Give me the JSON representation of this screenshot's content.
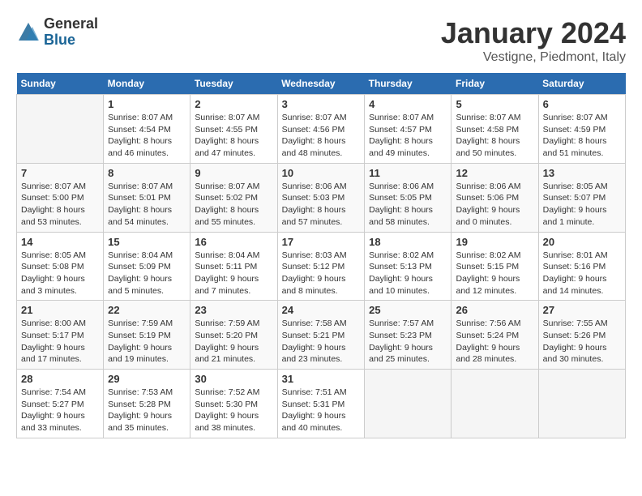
{
  "header": {
    "logo_general": "General",
    "logo_blue": "Blue",
    "title": "January 2024",
    "subtitle": "Vestigne, Piedmont, Italy"
  },
  "columns": [
    "Sunday",
    "Monday",
    "Tuesday",
    "Wednesday",
    "Thursday",
    "Friday",
    "Saturday"
  ],
  "weeks": [
    [
      {
        "day": "",
        "info": ""
      },
      {
        "day": "1",
        "info": "Sunrise: 8:07 AM\nSunset: 4:54 PM\nDaylight: 8 hours\nand 46 minutes."
      },
      {
        "day": "2",
        "info": "Sunrise: 8:07 AM\nSunset: 4:55 PM\nDaylight: 8 hours\nand 47 minutes."
      },
      {
        "day": "3",
        "info": "Sunrise: 8:07 AM\nSunset: 4:56 PM\nDaylight: 8 hours\nand 48 minutes."
      },
      {
        "day": "4",
        "info": "Sunrise: 8:07 AM\nSunset: 4:57 PM\nDaylight: 8 hours\nand 49 minutes."
      },
      {
        "day": "5",
        "info": "Sunrise: 8:07 AM\nSunset: 4:58 PM\nDaylight: 8 hours\nand 50 minutes."
      },
      {
        "day": "6",
        "info": "Sunrise: 8:07 AM\nSunset: 4:59 PM\nDaylight: 8 hours\nand 51 minutes."
      }
    ],
    [
      {
        "day": "7",
        "info": "Sunrise: 8:07 AM\nSunset: 5:00 PM\nDaylight: 8 hours\nand 53 minutes."
      },
      {
        "day": "8",
        "info": "Sunrise: 8:07 AM\nSunset: 5:01 PM\nDaylight: 8 hours\nand 54 minutes."
      },
      {
        "day": "9",
        "info": "Sunrise: 8:07 AM\nSunset: 5:02 PM\nDaylight: 8 hours\nand 55 minutes."
      },
      {
        "day": "10",
        "info": "Sunrise: 8:06 AM\nSunset: 5:03 PM\nDaylight: 8 hours\nand 57 minutes."
      },
      {
        "day": "11",
        "info": "Sunrise: 8:06 AM\nSunset: 5:05 PM\nDaylight: 8 hours\nand 58 minutes."
      },
      {
        "day": "12",
        "info": "Sunrise: 8:06 AM\nSunset: 5:06 PM\nDaylight: 9 hours\nand 0 minutes."
      },
      {
        "day": "13",
        "info": "Sunrise: 8:05 AM\nSunset: 5:07 PM\nDaylight: 9 hours\nand 1 minute."
      }
    ],
    [
      {
        "day": "14",
        "info": "Sunrise: 8:05 AM\nSunset: 5:08 PM\nDaylight: 9 hours\nand 3 minutes."
      },
      {
        "day": "15",
        "info": "Sunrise: 8:04 AM\nSunset: 5:09 PM\nDaylight: 9 hours\nand 5 minutes."
      },
      {
        "day": "16",
        "info": "Sunrise: 8:04 AM\nSunset: 5:11 PM\nDaylight: 9 hours\nand 7 minutes."
      },
      {
        "day": "17",
        "info": "Sunrise: 8:03 AM\nSunset: 5:12 PM\nDaylight: 9 hours\nand 8 minutes."
      },
      {
        "day": "18",
        "info": "Sunrise: 8:02 AM\nSunset: 5:13 PM\nDaylight: 9 hours\nand 10 minutes."
      },
      {
        "day": "19",
        "info": "Sunrise: 8:02 AM\nSunset: 5:15 PM\nDaylight: 9 hours\nand 12 minutes."
      },
      {
        "day": "20",
        "info": "Sunrise: 8:01 AM\nSunset: 5:16 PM\nDaylight: 9 hours\nand 14 minutes."
      }
    ],
    [
      {
        "day": "21",
        "info": "Sunrise: 8:00 AM\nSunset: 5:17 PM\nDaylight: 9 hours\nand 17 minutes."
      },
      {
        "day": "22",
        "info": "Sunrise: 7:59 AM\nSunset: 5:19 PM\nDaylight: 9 hours\nand 19 minutes."
      },
      {
        "day": "23",
        "info": "Sunrise: 7:59 AM\nSunset: 5:20 PM\nDaylight: 9 hours\nand 21 minutes."
      },
      {
        "day": "24",
        "info": "Sunrise: 7:58 AM\nSunset: 5:21 PM\nDaylight: 9 hours\nand 23 minutes."
      },
      {
        "day": "25",
        "info": "Sunrise: 7:57 AM\nSunset: 5:23 PM\nDaylight: 9 hours\nand 25 minutes."
      },
      {
        "day": "26",
        "info": "Sunrise: 7:56 AM\nSunset: 5:24 PM\nDaylight: 9 hours\nand 28 minutes."
      },
      {
        "day": "27",
        "info": "Sunrise: 7:55 AM\nSunset: 5:26 PM\nDaylight: 9 hours\nand 30 minutes."
      }
    ],
    [
      {
        "day": "28",
        "info": "Sunrise: 7:54 AM\nSunset: 5:27 PM\nDaylight: 9 hours\nand 33 minutes."
      },
      {
        "day": "29",
        "info": "Sunrise: 7:53 AM\nSunset: 5:28 PM\nDaylight: 9 hours\nand 35 minutes."
      },
      {
        "day": "30",
        "info": "Sunrise: 7:52 AM\nSunset: 5:30 PM\nDaylight: 9 hours\nand 38 minutes."
      },
      {
        "day": "31",
        "info": "Sunrise: 7:51 AM\nSunset: 5:31 PM\nDaylight: 9 hours\nand 40 minutes."
      },
      {
        "day": "",
        "info": ""
      },
      {
        "day": "",
        "info": ""
      },
      {
        "day": "",
        "info": ""
      }
    ]
  ]
}
